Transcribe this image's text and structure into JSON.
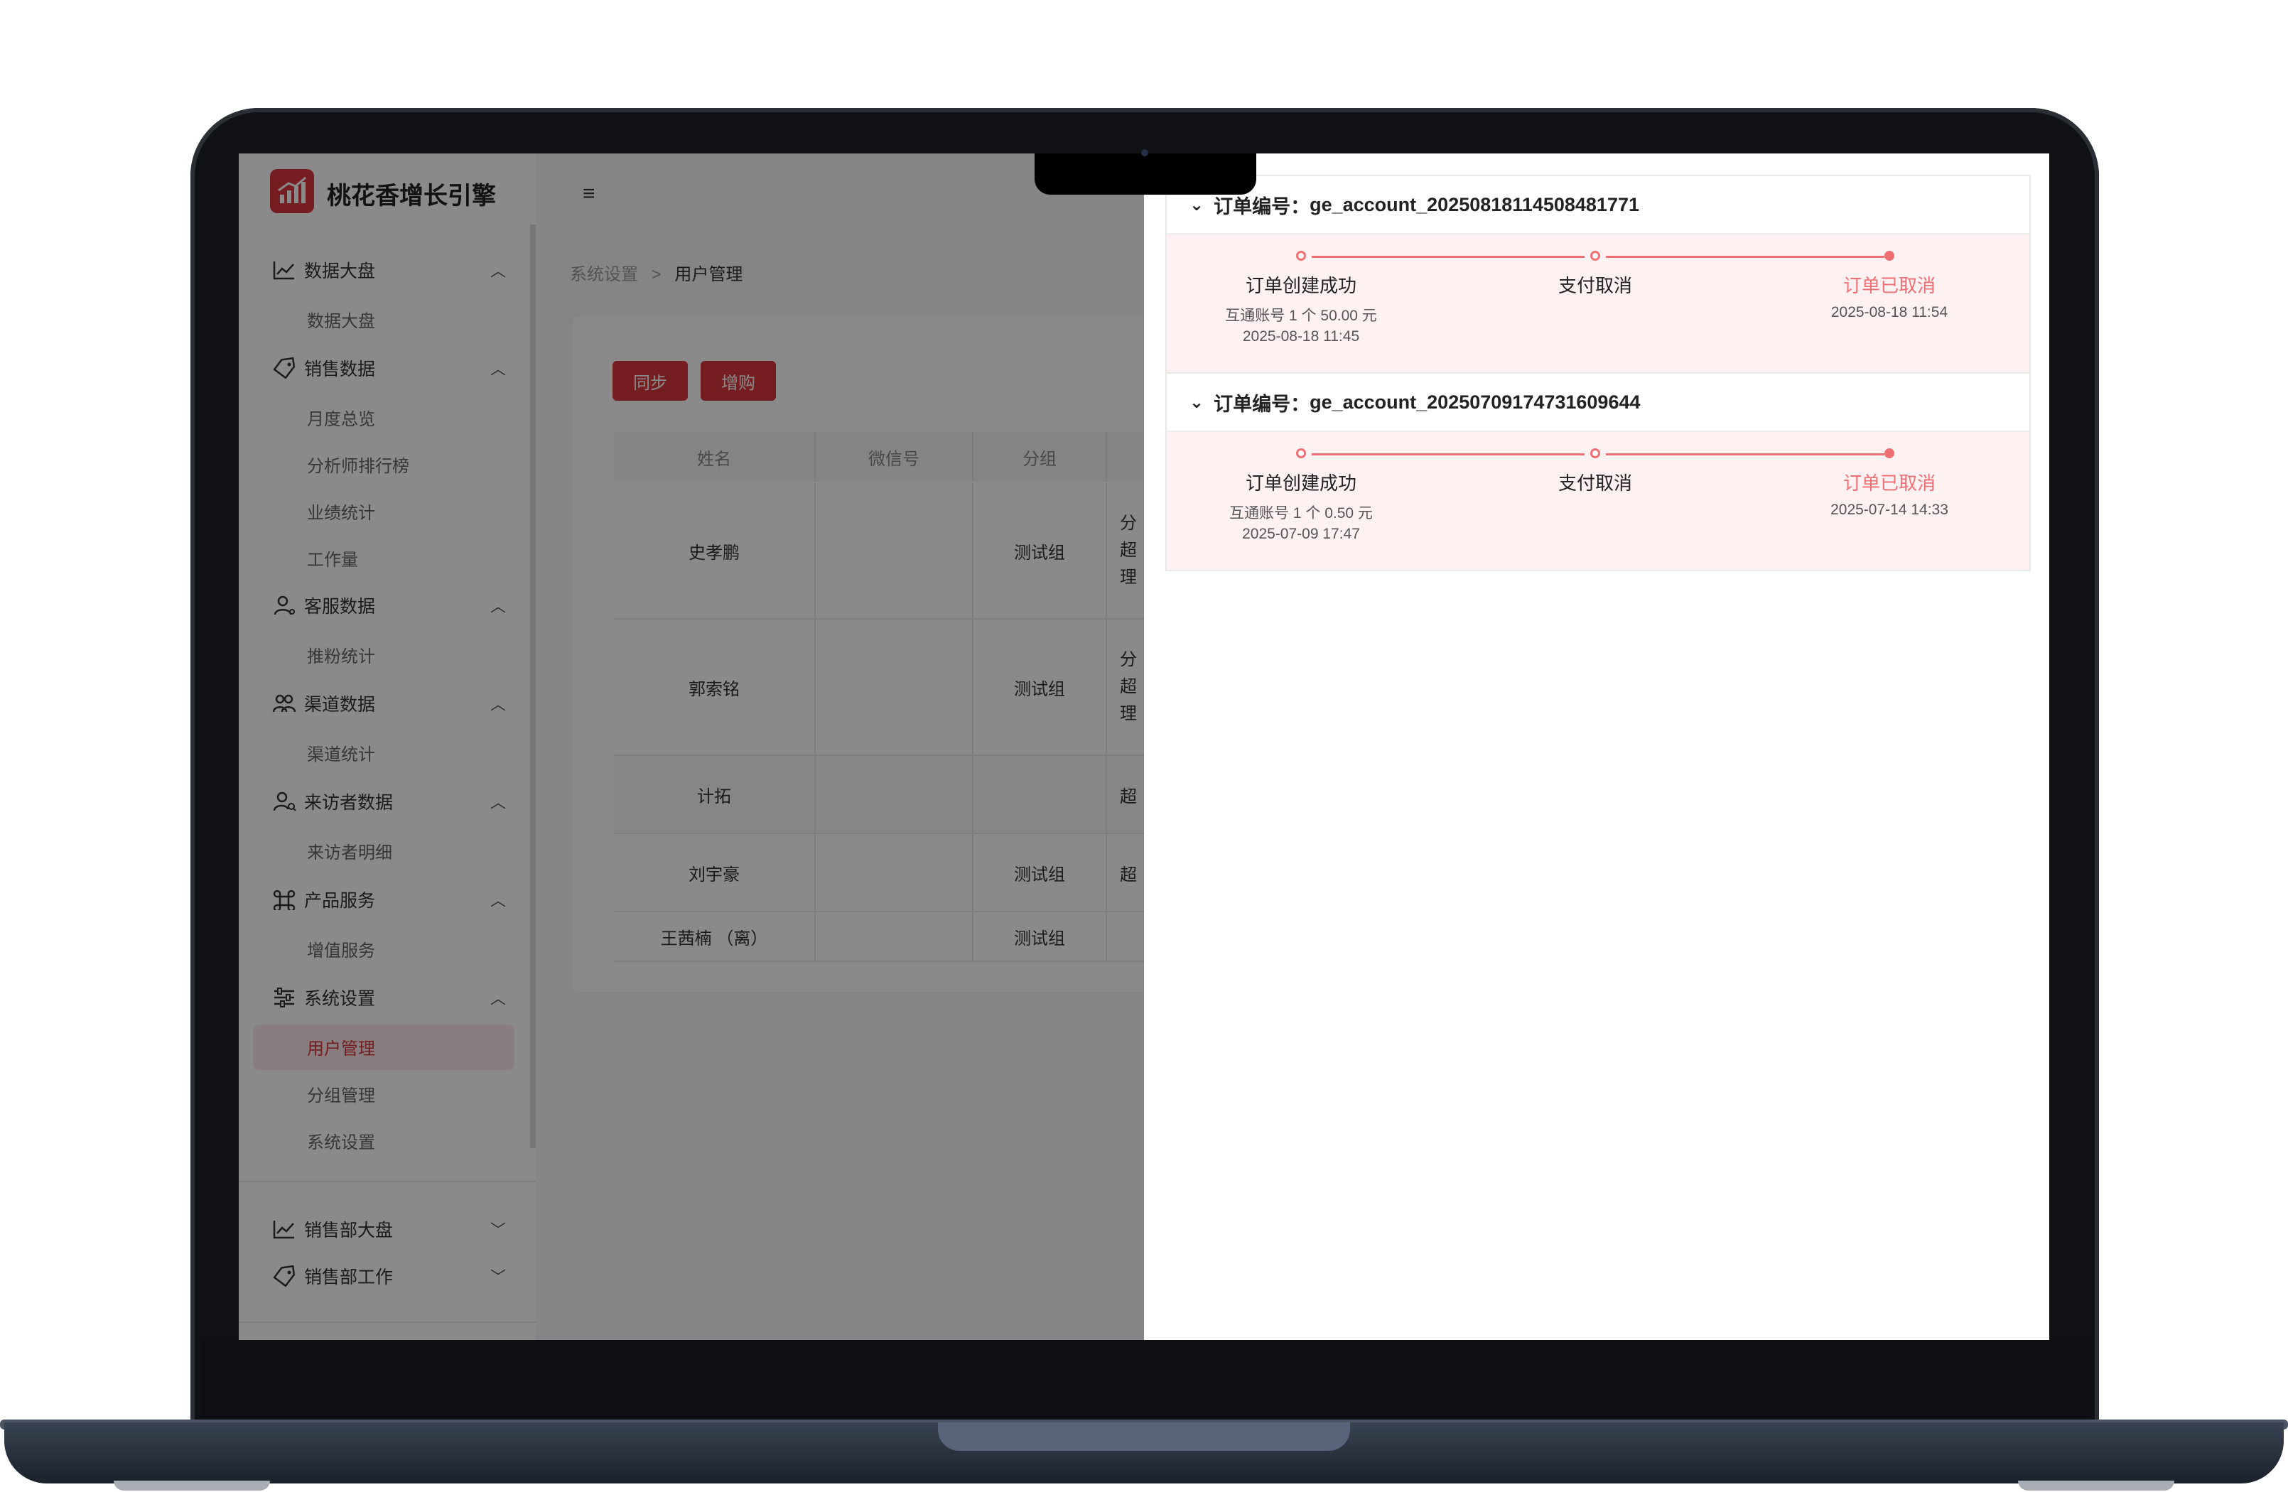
{
  "app": {
    "brand_title": "桃花香增长引擎",
    "accent_color": "#d9363e",
    "highlight_color": "#ee6f74"
  },
  "sidebar": {
    "groups": [
      {
        "label": "数据大盘",
        "icon": "chart-line-icon",
        "children": [
          "数据大盘"
        ]
      },
      {
        "label": "销售数据",
        "icon": "tag-icon",
        "children": [
          "月度总览",
          "分析师排行榜",
          "业绩统计",
          "工作量"
        ]
      },
      {
        "label": "客服数据",
        "icon": "user-icon",
        "children": [
          "推粉统计"
        ]
      },
      {
        "label": "渠道数据",
        "icon": "users-icon",
        "children": [
          "渠道统计"
        ]
      },
      {
        "label": "来访者数据",
        "icon": "user-search-icon",
        "children": [
          "来访者明细"
        ]
      },
      {
        "label": "产品服务",
        "icon": "command-icon",
        "children": [
          "增值服务"
        ]
      },
      {
        "label": "系统设置",
        "icon": "sliders-icon",
        "children": [
          "用户管理",
          "分组管理",
          "系统设置"
        ]
      }
    ],
    "bottom_groups": [
      {
        "label": "销售部大盘",
        "icon": "chart-line-icon"
      },
      {
        "label": "销售部工作",
        "icon": "tag-icon"
      }
    ],
    "active_item": "用户管理"
  },
  "breadcrumb": {
    "parent": "系统设置",
    "separator": ">",
    "current": "用户管理"
  },
  "toolbar": {
    "sync_label": "同步",
    "buy_label": "增购"
  },
  "table": {
    "headers": [
      "姓名",
      "微信号",
      "分组"
    ],
    "rows": [
      {
        "name": "史孝鹏",
        "wechat": "",
        "group": "测试组",
        "role": "分\n超\n理"
      },
      {
        "name": "郭索铭",
        "wechat": "",
        "group": "测试组",
        "role": "分\n超\n理"
      },
      {
        "name": "计拓",
        "wechat": "",
        "group": "",
        "role": "超"
      },
      {
        "name": "刘宇豪",
        "wechat": "",
        "group": "测试组",
        "role": "超"
      },
      {
        "name": "王茜楠 （离）",
        "wechat": "",
        "group": "测试组",
        "role": ""
      }
    ]
  },
  "orders": [
    {
      "label": "订单编号：",
      "id": "ge_account_20250818114508481771",
      "steps": [
        {
          "title": "订单创建成功",
          "line1": "互通账号 1 个 50.00 元",
          "line2": "2025-08-18 11:45"
        },
        {
          "title": "支付取消"
        },
        {
          "title": "订单已取消",
          "line1": "2025-08-18 11:54"
        }
      ]
    },
    {
      "label": "订单编号：",
      "id": "ge_account_20250709174731609644",
      "steps": [
        {
          "title": "订单创建成功",
          "line1": "互通账号 1 个 0.50 元",
          "line2": "2025-07-09 17:47"
        },
        {
          "title": "支付取消"
        },
        {
          "title": "订单已取消",
          "line1": "2025-07-14 14:33"
        }
      ]
    }
  ]
}
